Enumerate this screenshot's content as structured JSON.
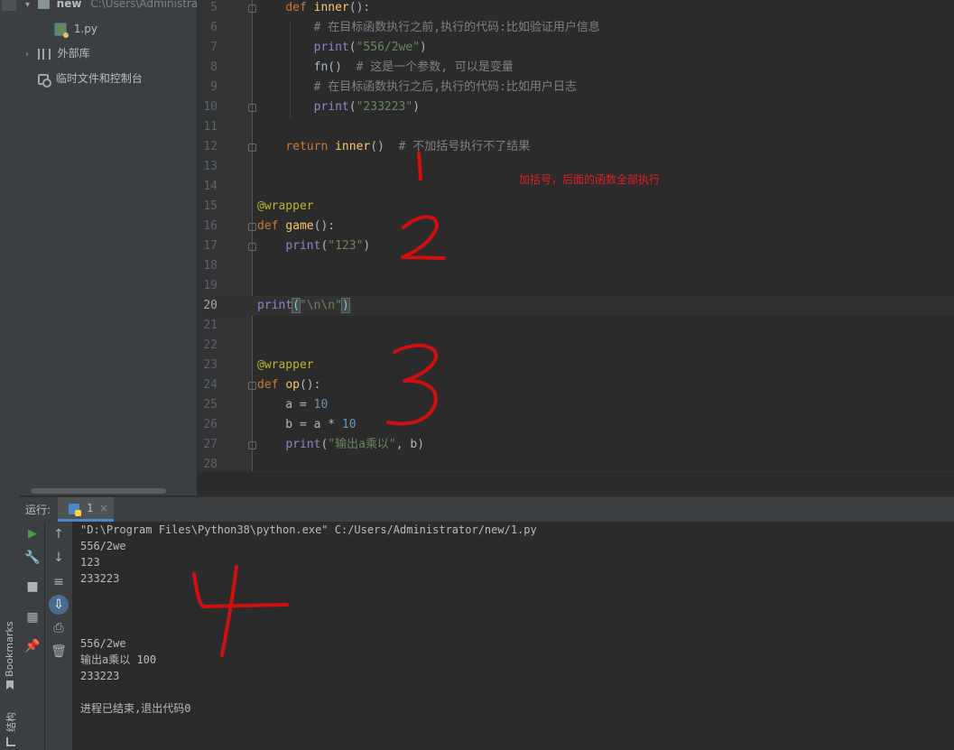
{
  "project_panel": {
    "root_label": "new",
    "root_path": "C:\\Users\\Administrato",
    "file": "1.py",
    "external_libs": "外部库",
    "scratches": "临时文件和控制台"
  },
  "side_tabs": {
    "bookmarks": "Bookmarks",
    "structure": "结构"
  },
  "editor": {
    "lines": [
      {
        "n": "5",
        "html": "    <span class='kw'>def</span> <span class='fn'>inner</span>():"
      },
      {
        "n": "6",
        "html": "        <span class='cmt'># 在目标函数执行之前,执行的代码:比如验证用户信息</span>"
      },
      {
        "n": "7",
        "html": "        <span class='bi'>print</span>(<span class='str'>\"556/2we\"</span>)"
      },
      {
        "n": "8",
        "html": "        fn()  <span class='cmt'># 这是一个参数, 可以是变量</span>"
      },
      {
        "n": "9",
        "html": "        <span class='cmt'># 在目标函数执行之后,执行的代码:比如用户日志</span>"
      },
      {
        "n": "10",
        "html": "        <span class='bi'>print</span>(<span class='str'>\"233223\"</span>)"
      },
      {
        "n": "11",
        "html": ""
      },
      {
        "n": "12",
        "html": "    <span class='kw'>return</span> <span class='fn'>inner</span>()  <span class='cmt'># 不加括号执行不了结果</span>"
      },
      {
        "n": "13",
        "html": ""
      },
      {
        "n": "14",
        "html": ""
      },
      {
        "n": "15",
        "html": "<span class='dec'>@wrapper</span>"
      },
      {
        "n": "16",
        "html": "<span class='kw'>def</span> <span class='fn'>game</span>():"
      },
      {
        "n": "17",
        "html": "    <span class='bi'>print</span>(<span class='str'>\"123\"</span>)"
      },
      {
        "n": "18",
        "html": ""
      },
      {
        "n": "19",
        "html": ""
      },
      {
        "n": "20",
        "html": "<span class='bi'>print</span><span class='sel-bracket'>(</span><span class='str'>\"\\n\\n\"</span><span class='sel-bracket'>)</span>"
      },
      {
        "n": "21",
        "html": ""
      },
      {
        "n": "22",
        "html": ""
      },
      {
        "n": "23",
        "html": "<span class='dec'>@wrapper</span>"
      },
      {
        "n": "24",
        "html": "<span class='kw'>def</span> <span class='fn'>op</span>():"
      },
      {
        "n": "25",
        "html": "    a = <span class='num'>10</span>"
      },
      {
        "n": "26",
        "html": "    b = a * <span class='num'>10</span>"
      },
      {
        "n": "27",
        "html": "    <span class='bi'>print</span>(<span class='str'>\"输出a乘以\"</span>, b)"
      },
      {
        "n": "28",
        "html": ""
      }
    ],
    "annotation": "加括号，后面的函数全部执行"
  },
  "run_panel": {
    "label": "运行:",
    "tab": "1",
    "close": "×",
    "console": [
      "\"D:\\Program Files\\Python38\\python.exe\" C:/Users/Administrator/new/1.py",
      "556/2we",
      "123",
      "233223",
      "",
      "",
      "",
      "556/2we",
      "输出a乘以 100",
      "233223",
      "",
      "进程已结束,退出代码0"
    ]
  }
}
